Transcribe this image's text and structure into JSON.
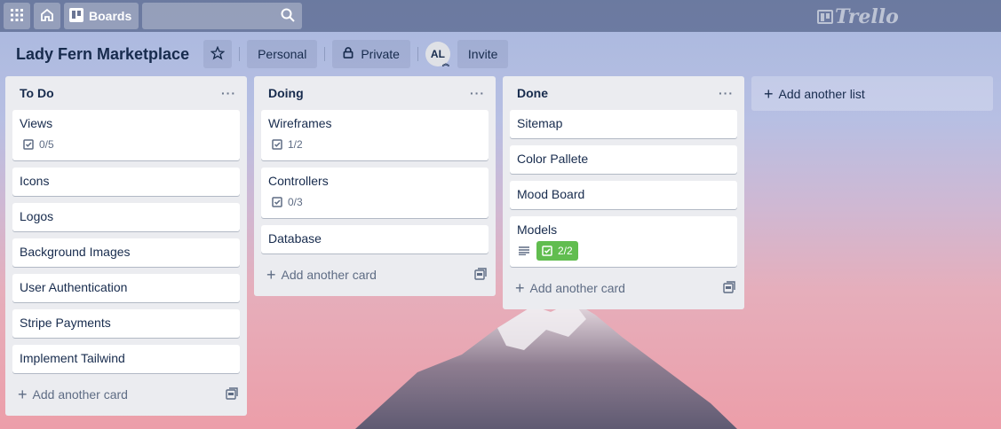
{
  "header": {
    "apps_icon": "grid-icon",
    "home_icon": "home-icon",
    "boards_label": "Boards",
    "search_placeholder": "",
    "logo_text": "Trello"
  },
  "board": {
    "title": "Lady Fern Marketplace",
    "visibility_team": "Personal",
    "visibility": "Private",
    "member_initials": "AL",
    "invite_label": "Invite"
  },
  "lists": [
    {
      "title": "To Do",
      "cards": [
        {
          "title": "Views",
          "checklist": "0/5"
        },
        {
          "title": "Icons"
        },
        {
          "title": "Logos"
        },
        {
          "title": "Background Images"
        },
        {
          "title": "User Authentication"
        },
        {
          "title": "Stripe Payments"
        },
        {
          "title": "Implement Tailwind"
        }
      ],
      "add_card_label": "Add another card"
    },
    {
      "title": "Doing",
      "cards": [
        {
          "title": "Wireframes",
          "checklist": "1/2"
        },
        {
          "title": "Controllers",
          "checklist": "0/3"
        },
        {
          "title": "Database"
        }
      ],
      "add_card_label": "Add another card"
    },
    {
      "title": "Done",
      "cards": [
        {
          "title": "Sitemap"
        },
        {
          "title": "Color Pallete"
        },
        {
          "title": "Mood Board"
        },
        {
          "title": "Models",
          "checklist": "2/2",
          "has_description": true
        }
      ],
      "add_card_label": "Add another card"
    }
  ],
  "add_list_label": "Add another list",
  "colors": {
    "complete_badge": "#61bd4f",
    "list_bg": "#ebecf0"
  }
}
